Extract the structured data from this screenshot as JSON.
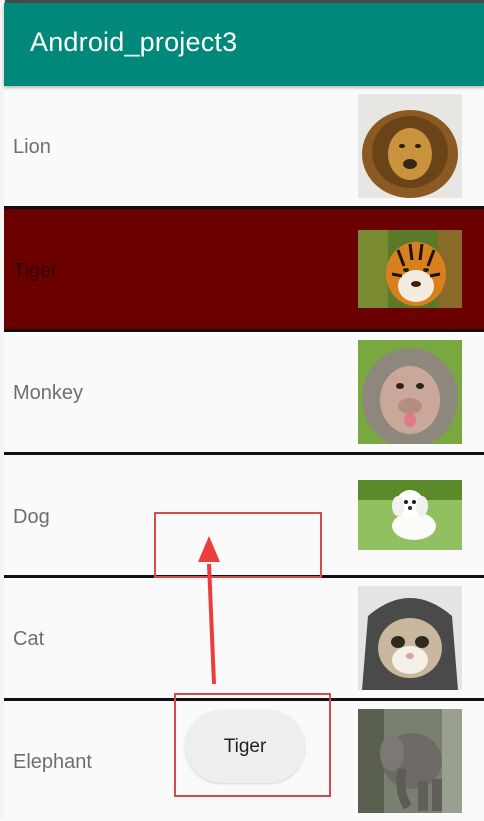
{
  "app": {
    "title": "Android_project3"
  },
  "list": {
    "items": [
      {
        "label": "Lion",
        "image": "lion-photo",
        "selected": false
      },
      {
        "label": "Tiger",
        "image": "tiger-photo",
        "selected": true
      },
      {
        "label": "Monkey",
        "image": "monkey-photo",
        "selected": false
      },
      {
        "label": "Dog",
        "image": "dog-photo",
        "selected": false
      },
      {
        "label": "Cat",
        "image": "cat-photo",
        "selected": false
      },
      {
        "label": "Elephant",
        "image": "elephant-photo",
        "selected": false
      }
    ]
  },
  "toast": {
    "text": "Tiger"
  },
  "colors": {
    "app_bar": "#00897b",
    "selected_row": "#6b0000",
    "annotation": "#d94a4a"
  },
  "annotations": {
    "arrow": "up-arrow-icon"
  }
}
